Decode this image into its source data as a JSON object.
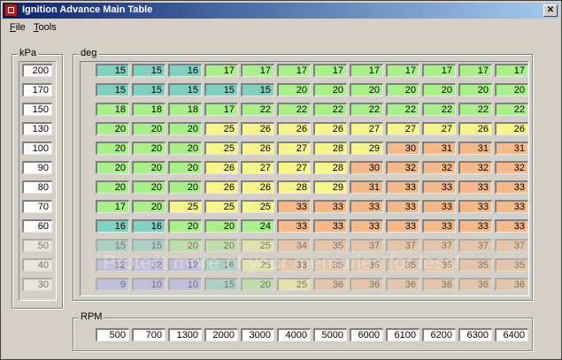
{
  "window": {
    "title": "Ignition Advance Main Table",
    "close_glyph": "✕"
  },
  "menu": [
    {
      "underline": "F",
      "rest": "ile"
    },
    {
      "underline": "T",
      "rest": "ools"
    }
  ],
  "kpa": {
    "label": "kPa",
    "values": [
      "200",
      "170",
      "150",
      "130",
      "100",
      "90",
      "80",
      "70",
      "60",
      "50",
      "40",
      "30"
    ]
  },
  "deg": {
    "label": "deg",
    "rows": [
      [
        "15",
        "15",
        "16",
        "17",
        "17",
        "17",
        "17",
        "17",
        "17",
        "17",
        "17",
        "17"
      ],
      [
        "15",
        "15",
        "15",
        "15",
        "15",
        "20",
        "20",
        "20",
        "20",
        "20",
        "20",
        "20"
      ],
      [
        "18",
        "18",
        "18",
        "17",
        "22",
        "22",
        "22",
        "22",
        "22",
        "22",
        "22",
        "22"
      ],
      [
        "20",
        "20",
        "20",
        "25",
        "26",
        "26",
        "26",
        "27",
        "27",
        "27",
        "26",
        "26"
      ],
      [
        "20",
        "20",
        "20",
        "25",
        "26",
        "27",
        "28",
        "29",
        "30",
        "31",
        "31",
        "31"
      ],
      [
        "20",
        "20",
        "20",
        "26",
        "27",
        "27",
        "28",
        "30",
        "32",
        "32",
        "32",
        "32"
      ],
      [
        "20",
        "20",
        "20",
        "26",
        "26",
        "28",
        "29",
        "31",
        "33",
        "33",
        "33",
        "33"
      ],
      [
        "17",
        "20",
        "25",
        "25",
        "25",
        "33",
        "33",
        "33",
        "33",
        "33",
        "33",
        "33"
      ],
      [
        "16",
        "16",
        "20",
        "20",
        "24",
        "33",
        "33",
        "33",
        "33",
        "33",
        "33",
        "33"
      ],
      [
        "15",
        "15",
        "20",
        "20",
        "25",
        "34",
        "35",
        "37",
        "37",
        "37",
        "37",
        "37"
      ],
      [
        "12",
        "12",
        "12",
        "16",
        "25",
        "33",
        "35",
        "35",
        "35",
        "35",
        "35",
        "35"
      ],
      [
        "9",
        "10",
        "10",
        "15",
        "20",
        "25",
        "36",
        "36",
        "36",
        "36",
        "36",
        "36"
      ]
    ]
  },
  "rpm": {
    "label": "RPM",
    "values": [
      "500",
      "700",
      "1300",
      "2000",
      "3000",
      "4000",
      "5000",
      "6000",
      "6100",
      "6200",
      "6300",
      "6400"
    ]
  },
  "watermark": "Protect more of your memories for less!",
  "colors": {
    "blue": "#aaaaf0",
    "teal": "#80d0c0",
    "green": "#aaf08a",
    "yellow": "#f5f58a",
    "orange": "#f5b98a",
    "title_start": "#0a246a",
    "title_end": "#a6caf0"
  }
}
